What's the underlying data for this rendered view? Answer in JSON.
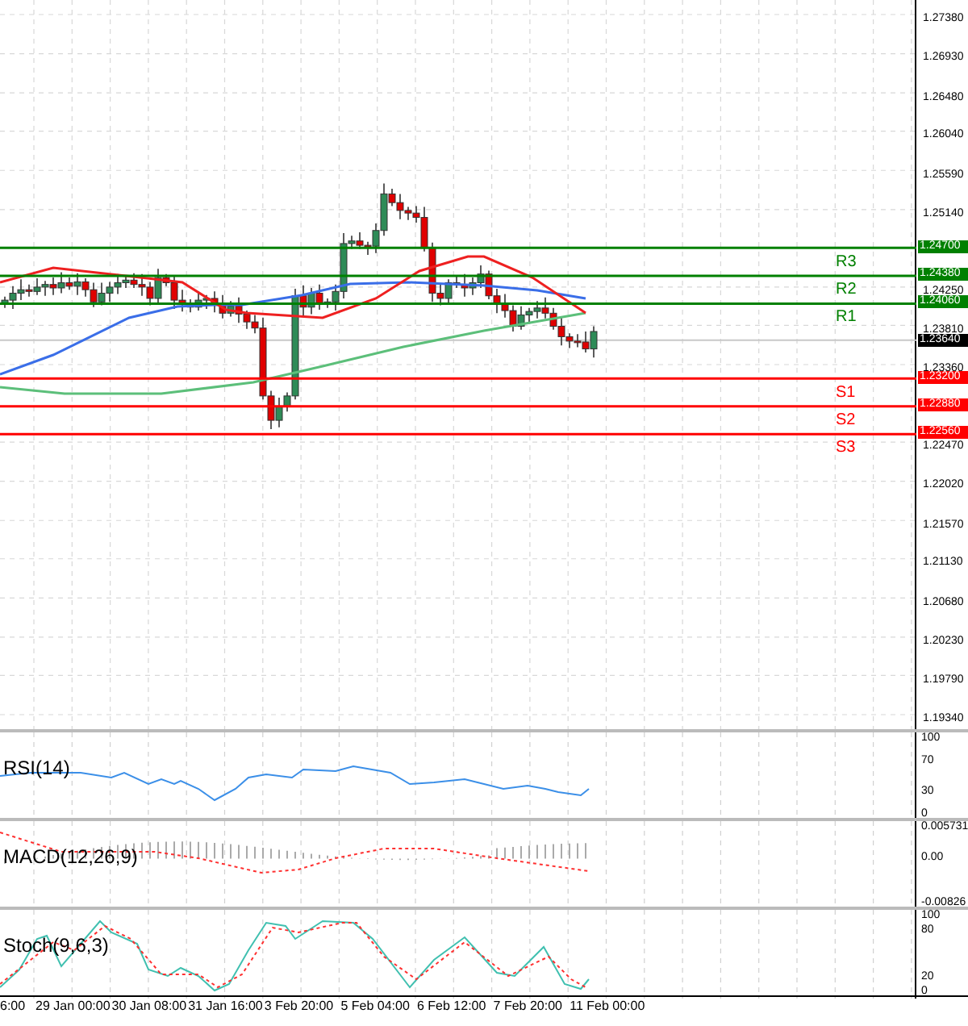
{
  "price_axis": {
    "ticks": [
      "1.27380",
      "1.26930",
      "1.26480",
      "1.26040",
      "1.25590",
      "1.25140",
      "1.24250",
      "1.23810",
      "1.23360",
      "1.22470",
      "1.22020",
      "1.21570",
      "1.21130",
      "1.20680",
      "1.20230",
      "1.19790",
      "1.19340"
    ],
    "current_price": "1.23640"
  },
  "levels": [
    {
      "name": "R3",
      "price": "1.24700",
      "kind": "resistance"
    },
    {
      "name": "R2",
      "price": "1.24380",
      "kind": "resistance"
    },
    {
      "name": "R1",
      "price": "1.24060",
      "kind": "resistance"
    },
    {
      "name": "S1",
      "price": "1.23200",
      "kind": "support"
    },
    {
      "name": "S2",
      "price": "1.22880",
      "kind": "support"
    },
    {
      "name": "S3",
      "price": "1.22560",
      "kind": "support"
    }
  ],
  "indicators": [
    {
      "kind": "rsi",
      "label": "RSI(14)",
      "ticks": [
        "100",
        "70",
        "30",
        "0"
      ]
    },
    {
      "kind": "macd",
      "label": "MACD(12,26,9)",
      "ticks": [
        "0.005731",
        "0.00",
        "-0.00826"
      ]
    },
    {
      "kind": "stoch",
      "label": "Stoch(9,6,3)",
      "ticks": [
        "100",
        "80",
        "20",
        "0"
      ]
    }
  ],
  "time_axis": {
    "labels": [
      "6:00",
      "29 Jan 00:00",
      "30 Jan 08:00",
      "31 Jan 16:00",
      "3 Feb 20:00",
      "5 Feb 04:00",
      "6 Feb 12:00",
      "7 Feb 20:00",
      "11 Feb 00:00"
    ]
  }
}
